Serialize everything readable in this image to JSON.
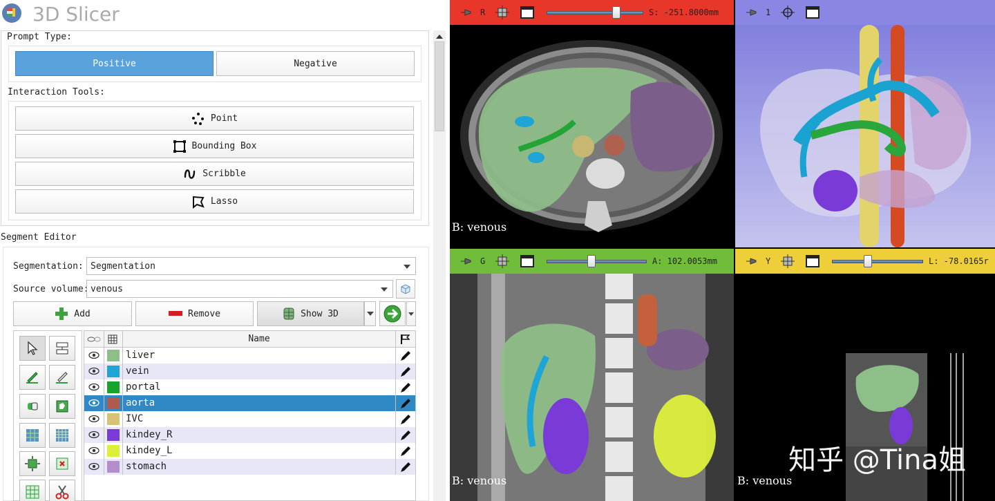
{
  "app": {
    "title": "3D Slicer"
  },
  "prompt_panel": {
    "prompt_type_label": "Prompt Type:",
    "positive_label": "Positive",
    "negative_label": "Negative",
    "interaction_tools_label": "Interaction Tools:",
    "tools": [
      {
        "label": "Point",
        "icon": "point-icon"
      },
      {
        "label": "Bounding Box",
        "icon": "bounding-box-icon"
      },
      {
        "label": "Scribble",
        "icon": "scribble-icon"
      },
      {
        "label": "Lasso",
        "icon": "lasso-icon"
      }
    ]
  },
  "segment_editor": {
    "title": "Segment Editor",
    "segmentation_label": "Segmentation:",
    "segmentation_value": "Segmentation",
    "source_volume_label": "Source volume:",
    "source_volume_value": "venous",
    "add_label": "Add",
    "remove_label": "Remove",
    "show3d_label": "Show 3D",
    "table": {
      "name_header": "Name",
      "segments": [
        {
          "name": "liver",
          "color": "#8fbf88"
        },
        {
          "name": "vein",
          "color": "#1ea5d6"
        },
        {
          "name": "portal",
          "color": "#18a32e"
        },
        {
          "name": "aorta",
          "color": "#b05a4e"
        },
        {
          "name": "IVC",
          "color": "#d8c274"
        },
        {
          "name": "kindey_R",
          "color": "#7a3ad8"
        },
        {
          "name": "kindey_L",
          "color": "#dcf03a"
        },
        {
          "name": "stomach",
          "color": "#b48ecb"
        }
      ],
      "selected_index": 3
    }
  },
  "views": {
    "red": {
      "letter": "R",
      "value": "S: -251.8000mm",
      "label": "B: venous",
      "color": "#e8362a",
      "slider": 0.74
    },
    "threed": {
      "letter": "1",
      "color": "#8a86e4"
    },
    "green": {
      "letter": "G",
      "value": "A: 102.0053mm",
      "label": "B: venous",
      "color": "#6fbd3a",
      "slider": 0.44
    },
    "yellow": {
      "letter": "Y",
      "value": "L: -78.0165r",
      "label": "B: venous",
      "color": "#eecf3a",
      "slider": 0.38
    }
  },
  "watermark": "知乎 @Tina姐"
}
